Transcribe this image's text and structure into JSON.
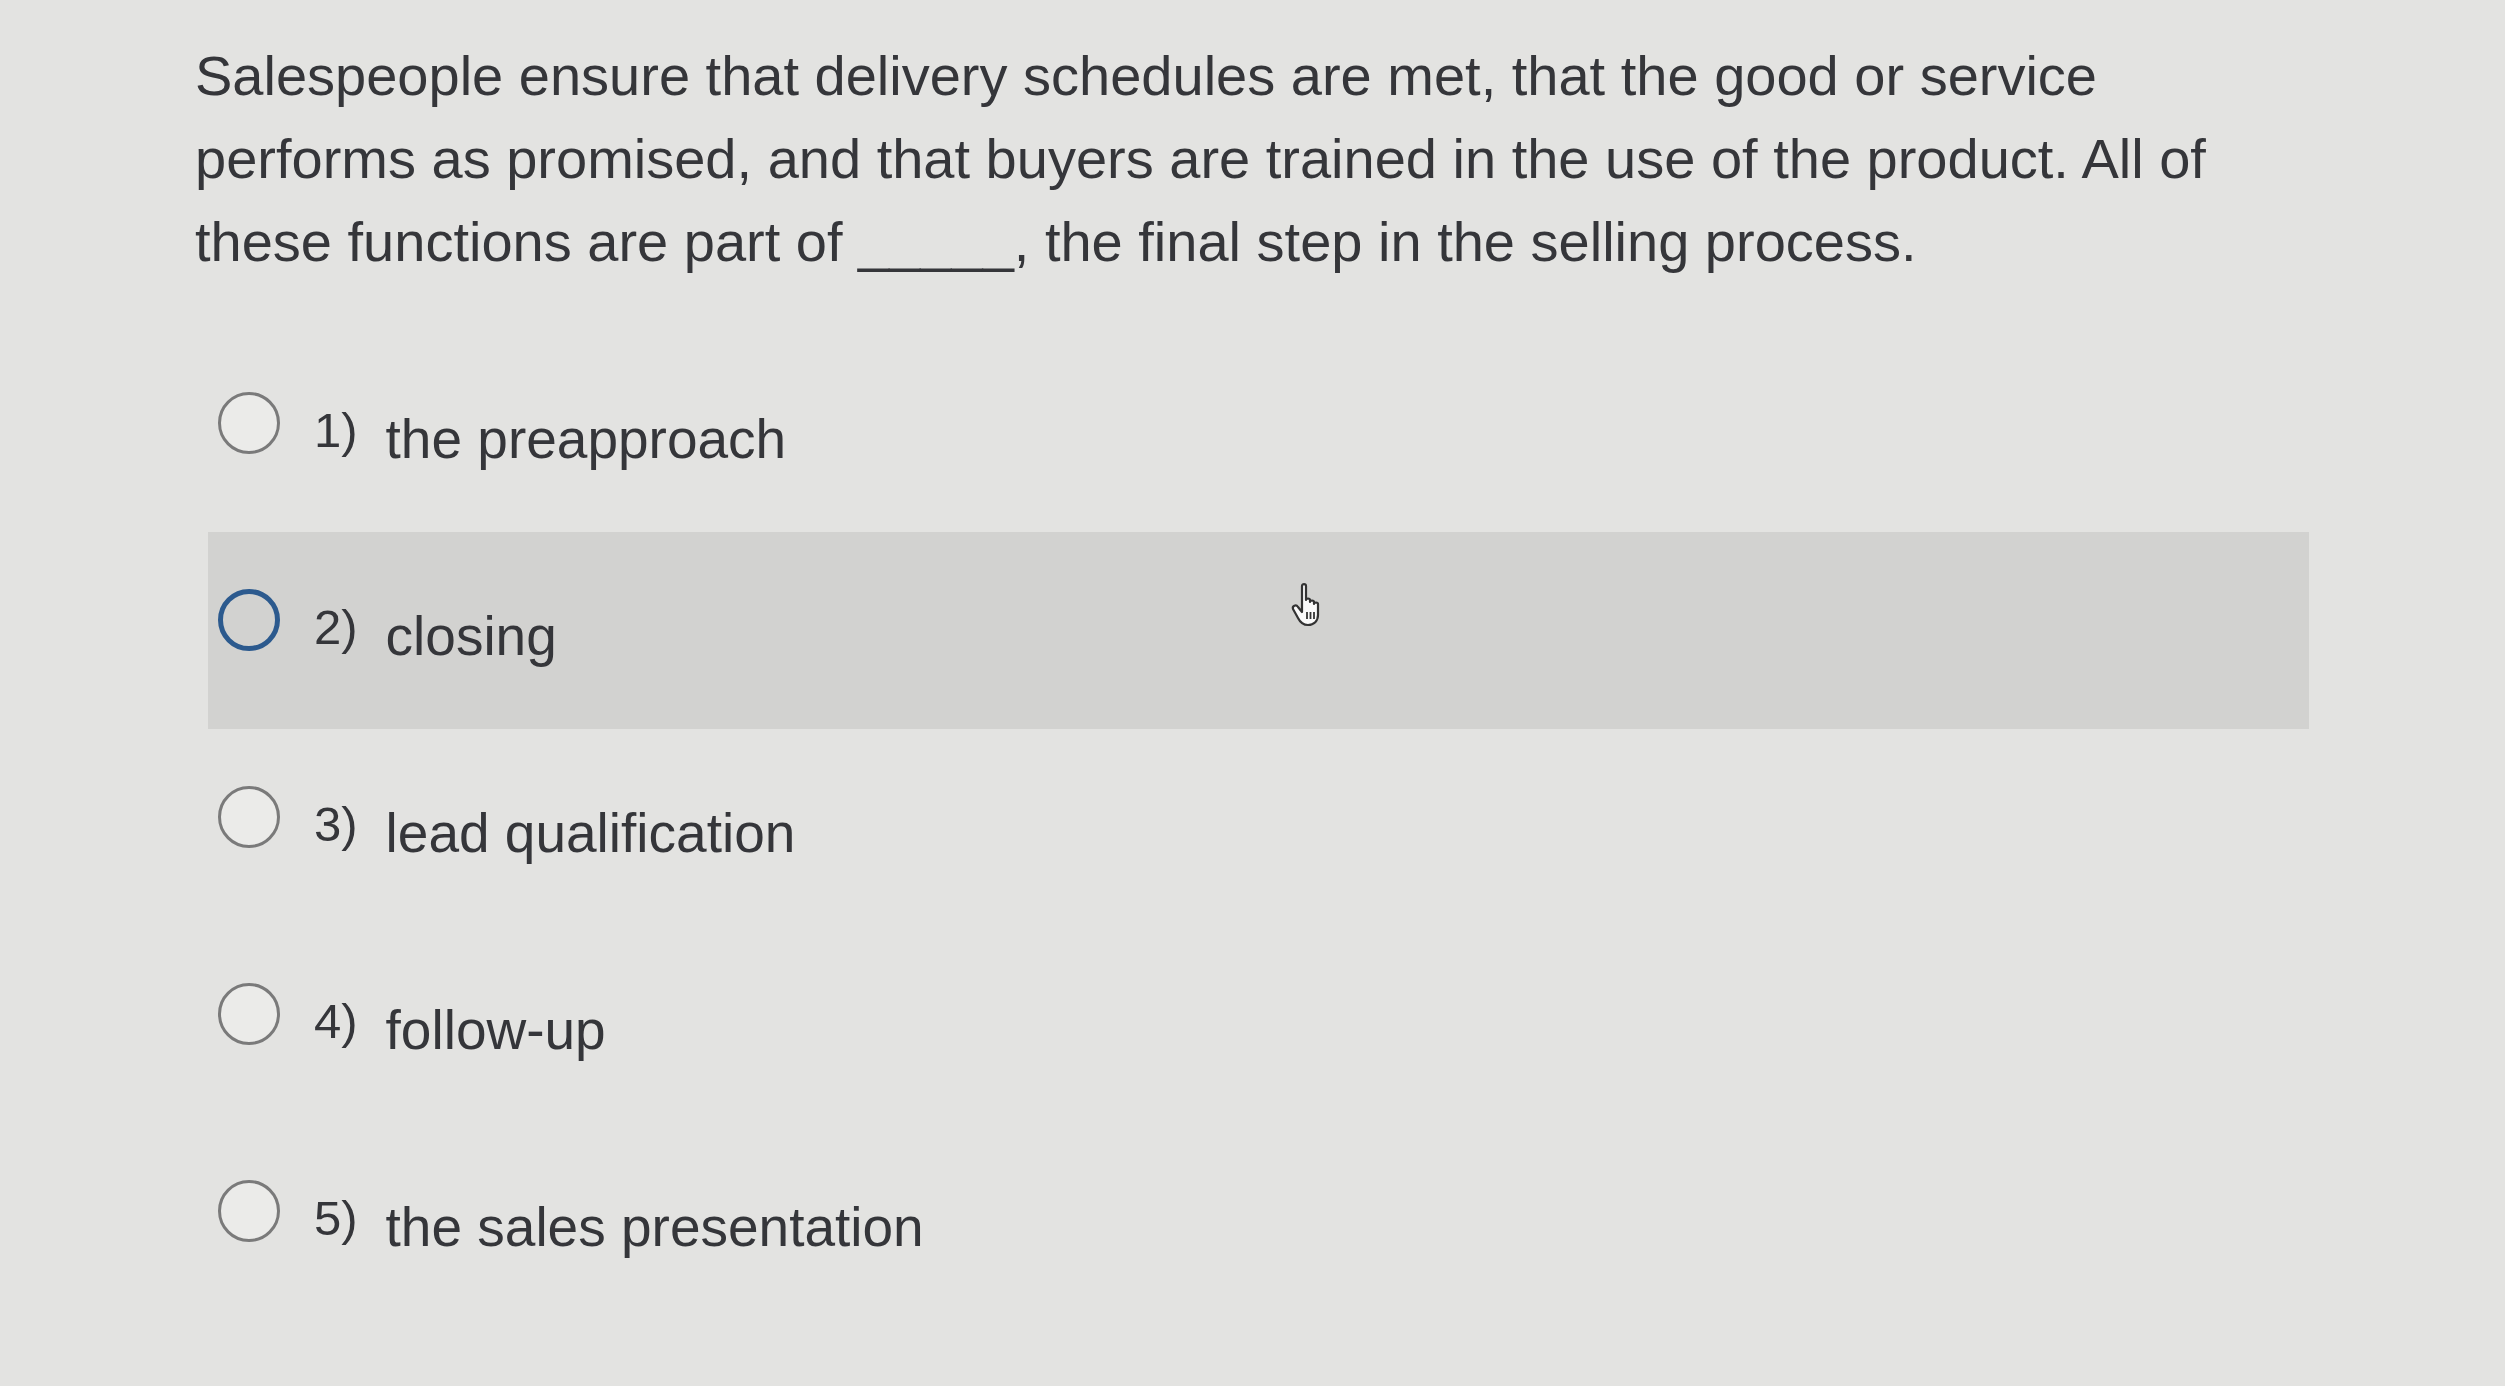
{
  "question": {
    "text": "Salespeople ensure that delivery schedules are met, that the good or service performs as promised, and that buyers are trained in the use of the product. All of these functions are part of _____, the final step in the selling process."
  },
  "options": [
    {
      "number": "1)",
      "label": "the preapproach",
      "selected": false,
      "highlighted": false
    },
    {
      "number": "2)",
      "label": "closing",
      "selected": false,
      "highlighted": true
    },
    {
      "number": "3)",
      "label": "lead qualification",
      "selected": false,
      "highlighted": false
    },
    {
      "number": "4)",
      "label": "follow-up",
      "selected": false,
      "highlighted": false
    },
    {
      "number": "5)",
      "label": "the sales presentation",
      "selected": false,
      "highlighted": false
    }
  ]
}
